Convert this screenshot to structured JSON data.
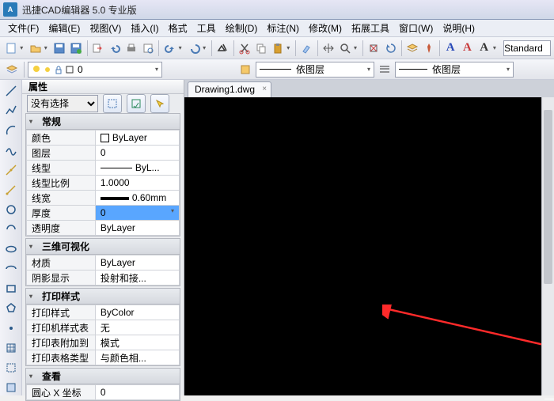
{
  "title": "迅捷CAD编辑器 5.0 专业版",
  "menus": [
    "文件(F)",
    "编辑(E)",
    "视图(V)",
    "插入(I)",
    "格式",
    "工具",
    "绘制(D)",
    "标注(N)",
    "修改(M)",
    "拓展工具",
    "窗口(W)",
    "说明(H)"
  ],
  "layer_combo_label": "依图层",
  "style_combo": "Standard",
  "panel_title": "属性",
  "sel_filter_empty": "没有选择",
  "cats": {
    "general": "常规",
    "visual3d": "三维可视化",
    "plot": "打印样式",
    "view": "查看"
  },
  "general": {
    "color_k": "颜色",
    "color_v": "ByLayer",
    "layer_k": "图层",
    "layer_v": "0",
    "ltype_k": "线型",
    "ltype_v": "ByL...",
    "ltscale_k": "线型比例",
    "ltscale_v": "1.0000",
    "lweight_k": "线宽",
    "lweight_v": "0.60mm",
    "thick_k": "厚度",
    "thick_v": "0",
    "trans_k": "透明度",
    "trans_v": "ByLayer"
  },
  "visual3d": {
    "material_k": "材质",
    "material_v": "ByLayer",
    "shadow_k": "阴影显示",
    "shadow_v": "投射和接..."
  },
  "plot": {
    "pstyle_k": "打印样式",
    "pstyle_v": "ByColor",
    "ptable_k": "打印机样式表",
    "ptable_v": "无",
    "pattach_k": "打印表附加到",
    "pattach_v": "模式",
    "pttype_k": "打印表格类型",
    "pttype_v": "与颜色相..."
  },
  "view": {
    "cx_k": "圆心 X 坐标",
    "cx_v": "0"
  },
  "doc_tab": "Drawing1.dwg",
  "colors": {
    "accent": "#59a6ff",
    "arrow": "#ff2a2a"
  }
}
